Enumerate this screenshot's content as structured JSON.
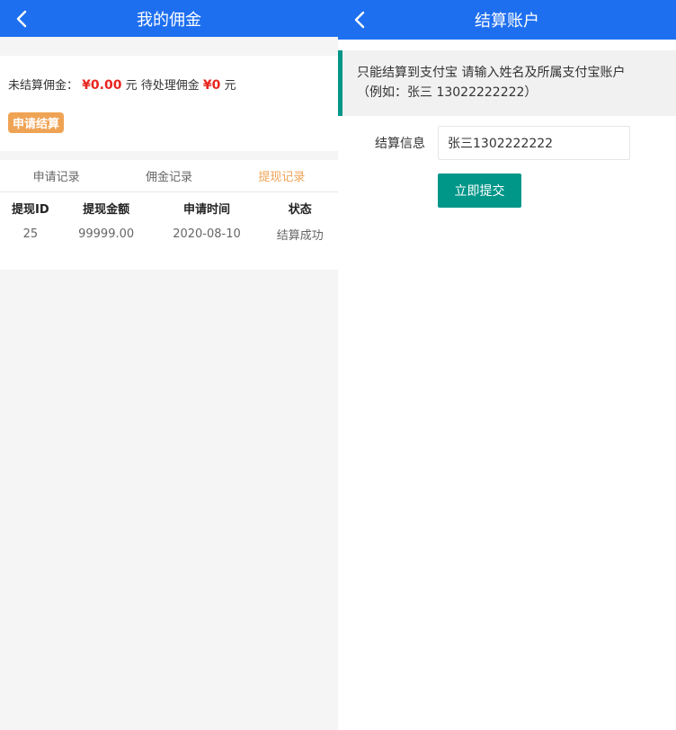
{
  "left": {
    "header": {
      "title": "我的佣金"
    },
    "summary": {
      "unsettled_label": "未结算佣金：",
      "unsettled_amount": "¥0.00",
      "unit1": "元",
      "pending_label": "待处理佣金",
      "pending_amount": "¥0",
      "unit2": "元",
      "apply_button": "申请结算"
    },
    "tabs": [
      {
        "label": "申请记录",
        "active": false
      },
      {
        "label": "佣金记录",
        "active": false
      },
      {
        "label": "提现记录",
        "active": true
      }
    ],
    "table": {
      "headers": [
        "提现ID",
        "提现金额",
        "申请时间",
        "状态"
      ],
      "rows": [
        [
          "25",
          "99999.00",
          "2020-08-10",
          "结算成功"
        ]
      ]
    }
  },
  "right": {
    "header": {
      "title": "结算账户"
    },
    "notice": {
      "line1": "只能结算到支付宝 请输入姓名及所属支付宝账户",
      "line2": "（例如：张三 13022222222）"
    },
    "form": {
      "label": "结算信息",
      "value": "张三1302222222",
      "submit": "立即提交"
    }
  },
  "colors": {
    "header_blue": "#1e6ff0",
    "accent_orange": "#efa354",
    "amount_red": "#e8261f",
    "teal": "#009688"
  },
  "icons": {
    "back": "chevron-left-icon"
  }
}
